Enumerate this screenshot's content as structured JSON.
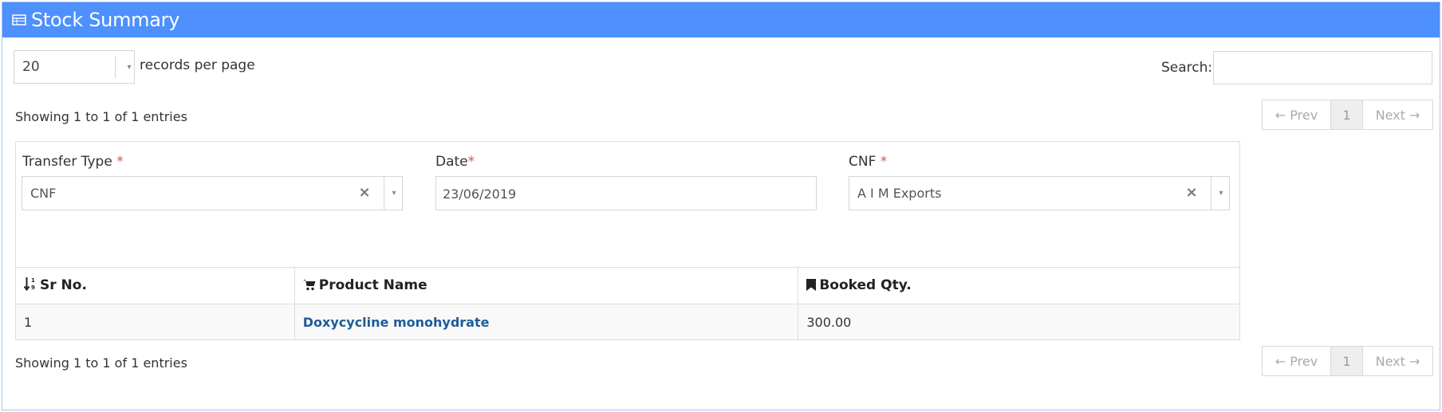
{
  "panel": {
    "title": "Stock Summary"
  },
  "length_menu": {
    "value": "20",
    "label": "records per page"
  },
  "search": {
    "label": "Search:",
    "value": ""
  },
  "info_top": "Showing 1 to 1 of 1 entries",
  "info_bottom": "Showing 1 to 1 of 1 entries",
  "pagination": {
    "prev": "← Prev",
    "current": "1",
    "next": "Next →"
  },
  "form": {
    "transfer_type": {
      "label": "Transfer Type",
      "required_mark": "*",
      "value": "CNF"
    },
    "date": {
      "label": "Date",
      "required_mark": "*",
      "value": "23/06/2019"
    },
    "cnf": {
      "label": "CNF",
      "required_mark": "*",
      "value": "A I M Exports"
    },
    "clear_glyph": "×",
    "caret_glyph": "▾"
  },
  "table": {
    "headers": [
      {
        "label": "Sr No.",
        "icon": "sort-numeric-icon"
      },
      {
        "label": "Product Name",
        "icon": "shopping-cart-icon"
      },
      {
        "label": "Booked Qty.",
        "icon": "bookmark-icon"
      }
    ],
    "rows": [
      {
        "sr_no": "1",
        "product_name": "Doxycycline monohydrate",
        "booked_qty": "300.00"
      }
    ]
  },
  "colors": {
    "header_bg": "#4d90fe",
    "link": "#1f5c99",
    "required": "#d15b47"
  }
}
